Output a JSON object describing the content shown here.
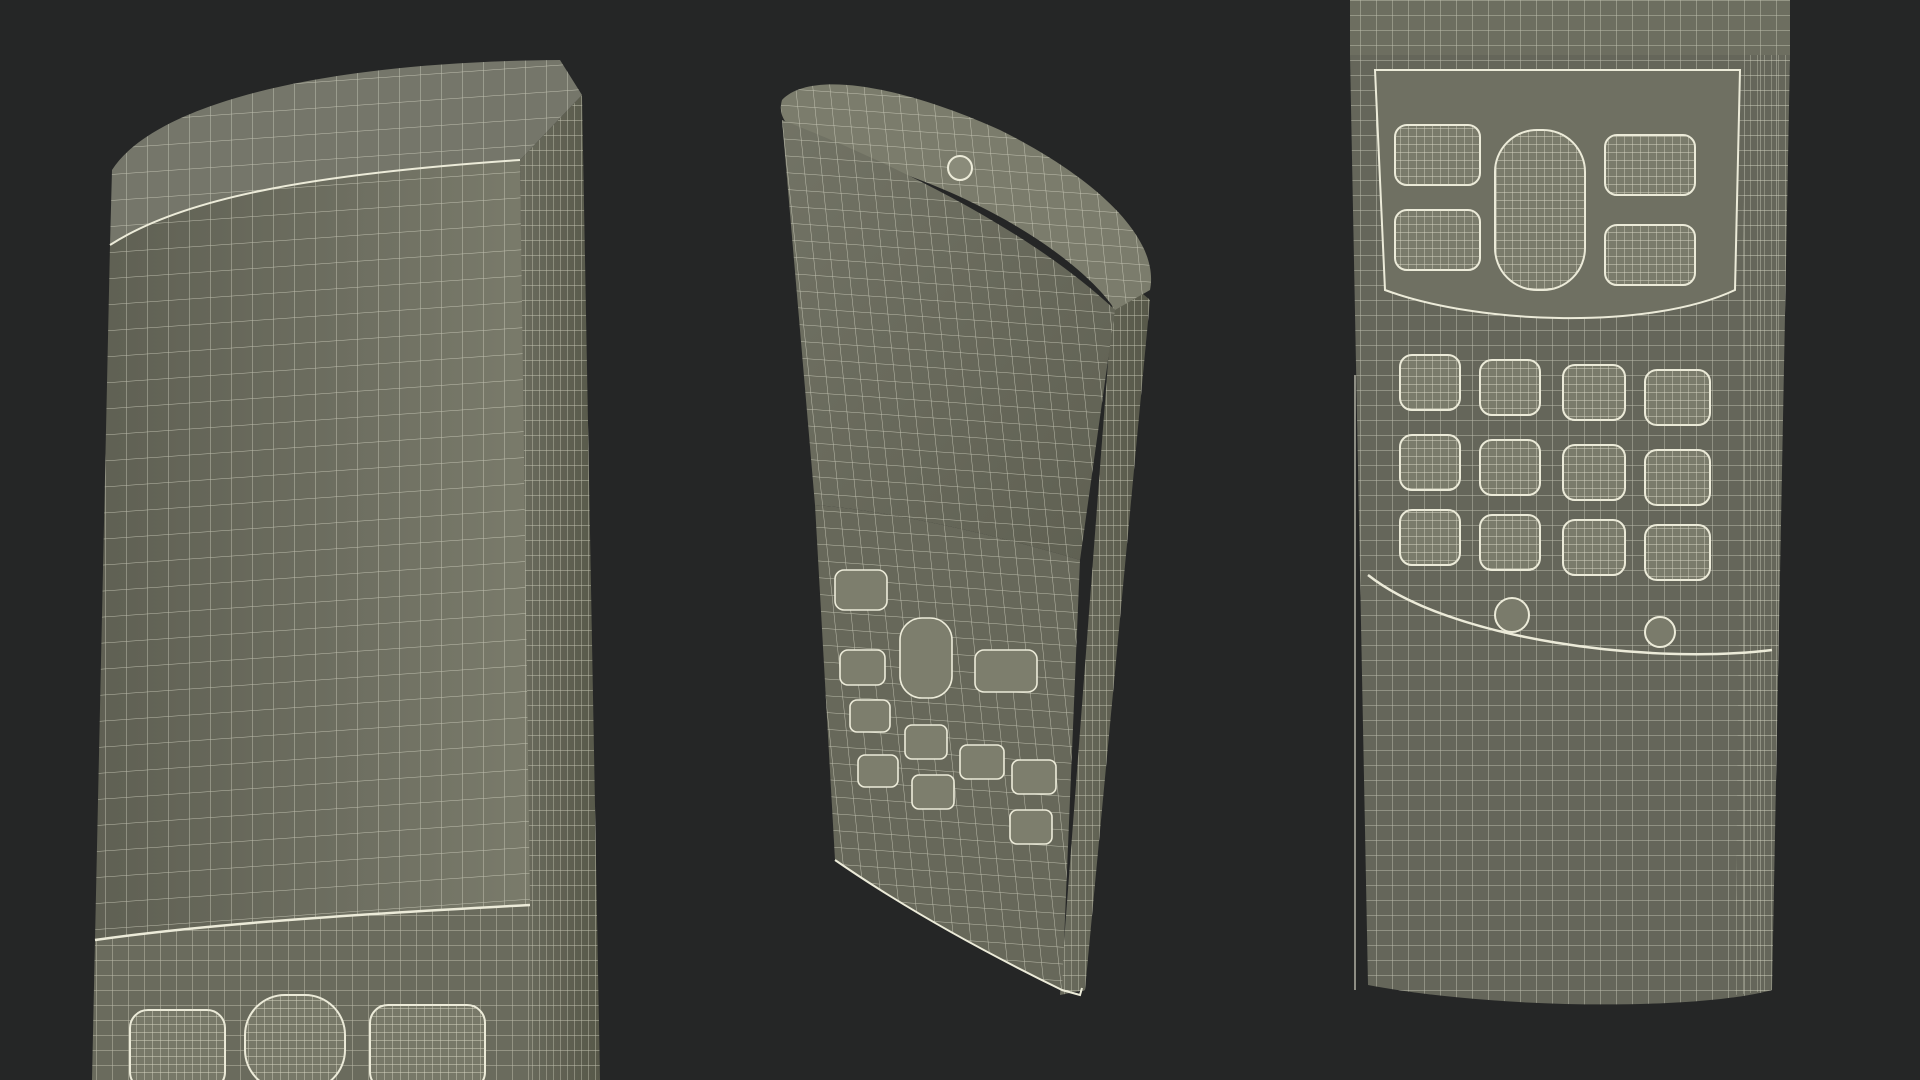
{
  "scene": {
    "background": "#252626",
    "surface_fill": "#6b6c5e",
    "surface_fill_light": "#767767",
    "surface_fill_dark": "#595a4e",
    "wire_color": "#d8d8c6",
    "wire_color_bright": "#ecebd9",
    "views": [
      {
        "id": "view-left-front",
        "object": "slider-phone",
        "angle": "front-close"
      },
      {
        "id": "view-center-angled",
        "object": "slider-phone",
        "angle": "three-quarter"
      },
      {
        "id": "view-right-keypad",
        "object": "slider-phone",
        "angle": "keypad-close"
      }
    ]
  }
}
